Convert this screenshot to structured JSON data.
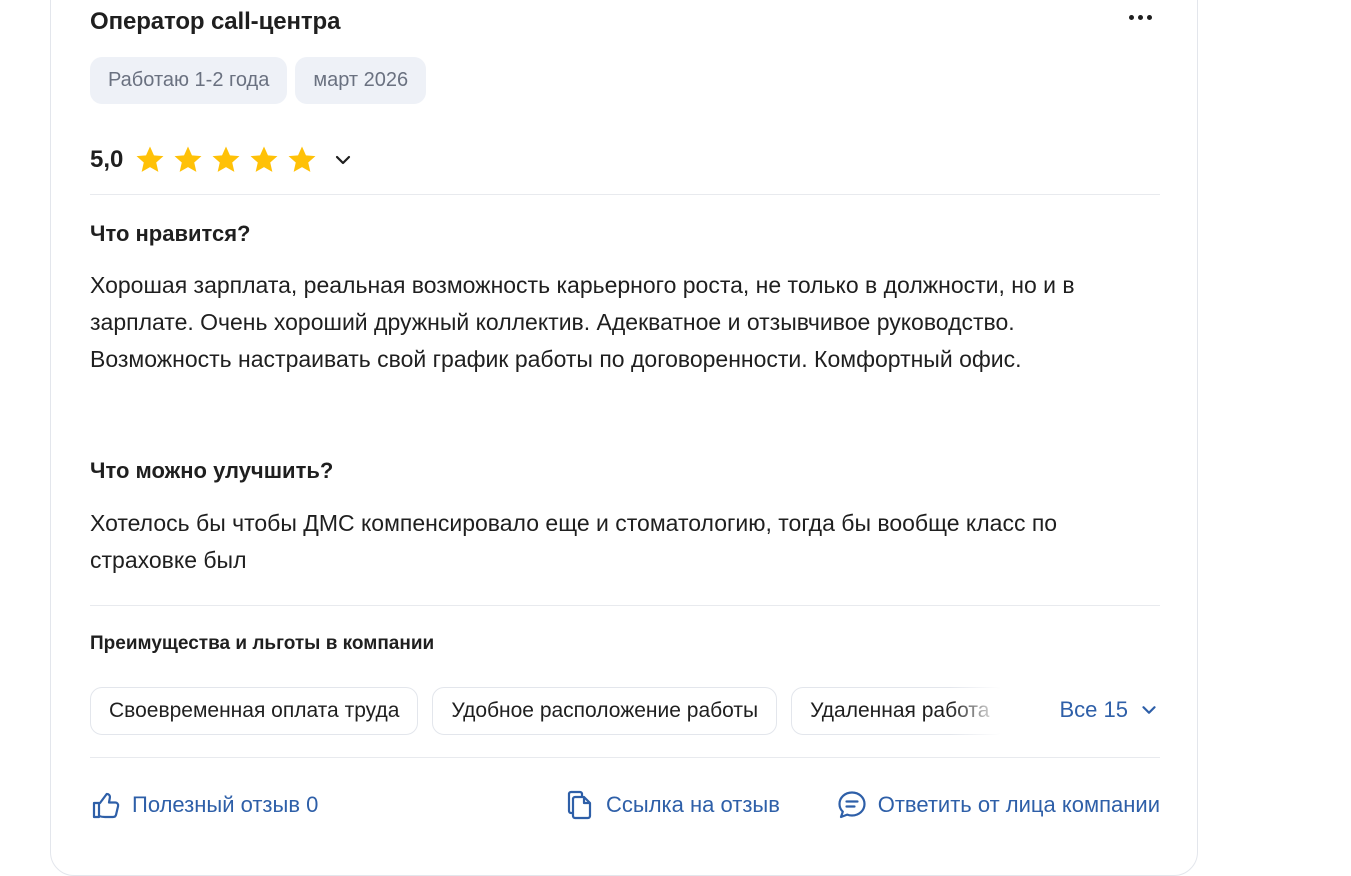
{
  "review": {
    "title": "Оператор call-центра",
    "tags": [
      "Работаю 1-2 года",
      "март 2026"
    ],
    "rating": "5,0",
    "stars": 5,
    "likes_heading": "Что нравится?",
    "likes_text": "Хорошая зарплата, реальная возможность карьерного роста, не только в должности, но и в зарплате. Очень хороший дружный коллектив. Адекватное и отзывчивое руководство. Возможность настраивать свой график работы по договоренности. Комфортный офис.",
    "improve_heading": "Что можно улучшить?",
    "improve_text": "Хотелось бы чтобы ДМС компенсировало еще и стоматологию, тогда бы вообще класс по страховке был"
  },
  "benefits": {
    "heading": "Преимущества и льготы в компании",
    "chips": [
      "Своевременная оплата труда",
      "Удобное расположение работы",
      "Удаленная работа"
    ],
    "all_label": "Все 15"
  },
  "actions": {
    "helpful_label": "Полезный отзыв 0",
    "link_label": "Ссылка на отзыв",
    "reply_label": "Ответить от лица компании"
  },
  "colors": {
    "star": "#ffc107",
    "link": "#2e5fa8",
    "tag_bg": "#eef1f7",
    "tag_text": "#6a7180"
  },
  "icons": {
    "more": "more-horizontal-icon",
    "star": "star-icon",
    "chevron": "chevron-down-icon",
    "thumb": "thumb-up-icon",
    "copy": "copy-link-icon",
    "chat": "chat-bubble-icon"
  }
}
